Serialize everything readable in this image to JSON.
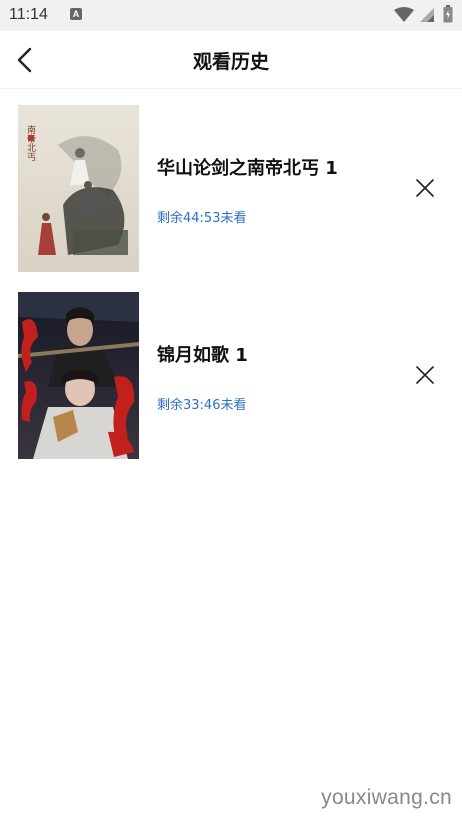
{
  "status_bar": {
    "time": "11:14",
    "notification_icon": "A",
    "icons": [
      "wifi-icon",
      "signal-icon",
      "battery-icon"
    ]
  },
  "header": {
    "title": "观看历史",
    "back_icon": "chevron-left-icon"
  },
  "history": [
    {
      "title": "华山论剑之南帝北丐 1",
      "progress": "剩余44:53未看",
      "poster_icon": "poster-image",
      "remove_icon": "close-icon"
    },
    {
      "title": "锦月如歌 1",
      "progress": "剩余33:46未看",
      "poster_icon": "poster-image",
      "remove_icon": "close-icon"
    }
  ],
  "watermark": "youxiwang.cn",
  "colors": {
    "accent": "#2f6fc6",
    "title_text": "#111111",
    "status_bar_bg": "#f1f1f1"
  }
}
